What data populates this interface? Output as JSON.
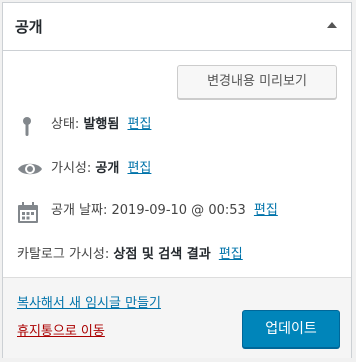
{
  "panel": {
    "title": "공개",
    "toggle_icon": "triangle-up-icon"
  },
  "preview_button": {
    "label": "변경내용 미리보기"
  },
  "status": {
    "icon": "pin-icon",
    "label": "상태:",
    "value": "발행됨",
    "edit": "편집"
  },
  "visibility": {
    "icon": "eye-icon",
    "label": "가시성:",
    "value": "공개",
    "edit": "편집"
  },
  "publish_date": {
    "icon": "calendar-icon",
    "label": "공개 날짜:",
    "value": "2019-09-10 @ 00:53",
    "edit": "편집"
  },
  "catalog_visibility": {
    "label": "카탈로그 가시성:",
    "value": "상점 및 검색 결과",
    "edit": "편집"
  },
  "footer": {
    "copy_link": "복사해서 새 임시글 만들기",
    "trash_link": "휴지통으로 이동",
    "update_button": "업데이트"
  },
  "colors": {
    "link": "#0073aa",
    "trash": "#aa0000",
    "primary_button": "#0085ba"
  }
}
